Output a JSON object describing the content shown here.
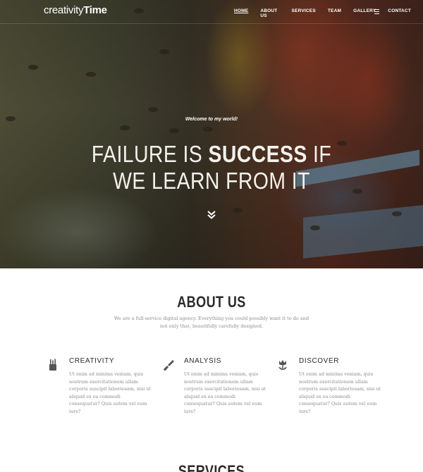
{
  "brand": {
    "light": "creativity",
    "bold": "Time"
  },
  "nav": {
    "items": [
      {
        "label": "HOME",
        "active": true
      },
      {
        "label": "ABOUT US",
        "active": false
      },
      {
        "label": "SERVICES",
        "active": false
      },
      {
        "label": "TEAM",
        "active": false
      },
      {
        "label": "GALLERY",
        "active": false
      },
      {
        "label": "CONTACT",
        "active": false
      }
    ],
    "menu_icon": "hamburger-icon"
  },
  "hero": {
    "welcome": "Welcome to my world!",
    "headline_part1": "FAILURE IS ",
    "headline_bold": "SUCCESS",
    "headline_part2": " IF",
    "headline_line2": "WE LEARN FROM IT",
    "scroll_icon": "double-chevron-down-icon"
  },
  "about": {
    "title": "ABOUT US",
    "text": "We are a full-service digital agency. Everything you could possibly want it to do and not only that, beautifully carefully designed.",
    "features": [
      {
        "title": "CREATIVITY",
        "icon": "pencil-cup-icon",
        "text": "Ut enim ad minima veniam, quis nostrum exercitationem ullam corporis suscipit laboriosam, nisi ut aliquid ex ea commodi consequatur? Quis autem vel eum iure?"
      },
      {
        "title": "ANALYSIS",
        "icon": "paintbrush-icon",
        "text": "Ut enim ad minima veniam, quis nostrum exercitationem ullam corporis suscipit laboriosam, nisi ut aliquid ex ea commodi consequatur? Quis autem vel eum iure?"
      },
      {
        "title": "DISCOVER",
        "icon": "flower-icon",
        "text": "Ut enim ad minima veniam, quis nostrum exercitationem ullam corporis suscipit laboriosam, nisi ut aliquid ex ea commodi consequatur? Quis autem vel eum iure?"
      }
    ]
  },
  "services": {
    "title": "SERVICES"
  },
  "colors": {
    "heading": "#2b2b2b",
    "body_text": "#8c8c8c",
    "hero_text": "#ffffff"
  }
}
